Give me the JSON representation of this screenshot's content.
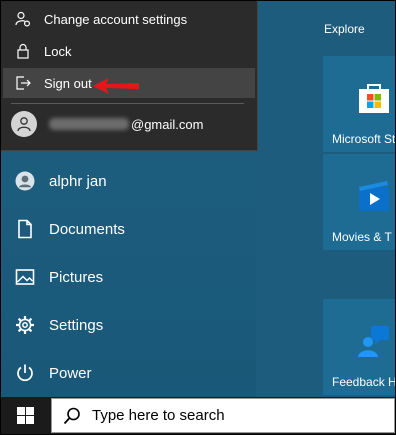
{
  "flyout": {
    "items": [
      {
        "label": "Change account settings",
        "icon": "person-gear-icon"
      },
      {
        "label": "Lock",
        "icon": "lock-icon"
      },
      {
        "label": "Sign out",
        "icon": "sign-out-icon"
      }
    ],
    "account_email_suffix": "@gmail.com",
    "avatar_icon": "person-icon"
  },
  "start_menu": {
    "nav": [
      {
        "label": "alphr jan",
        "icon": "user-avatar-icon"
      },
      {
        "label": "Documents",
        "icon": "document-icon"
      },
      {
        "label": "Pictures",
        "icon": "picture-icon"
      },
      {
        "label": "Settings",
        "icon": "gear-icon"
      },
      {
        "label": "Power",
        "icon": "power-icon"
      }
    ],
    "collapse_glyph": "⌄"
  },
  "tiles": {
    "group_title": "Explore",
    "items": [
      {
        "label": "Microsoft St",
        "icon": "microsoft-store-icon"
      },
      {
        "label": "Movies & T",
        "icon": "movies-tv-icon"
      },
      {
        "label": "Feedback H",
        "icon": "feedback-hub-icon"
      }
    ]
  },
  "taskbar": {
    "search_placeholder": "Type here to search",
    "start_icon": "windows-logo-icon",
    "search_icon": "search-icon"
  },
  "colors": {
    "annotation_arrow": "#e01818",
    "start_bg": "#1f5f80",
    "flyout_bg": "#2b2b2b",
    "tile_bg": "#1e6c94"
  }
}
